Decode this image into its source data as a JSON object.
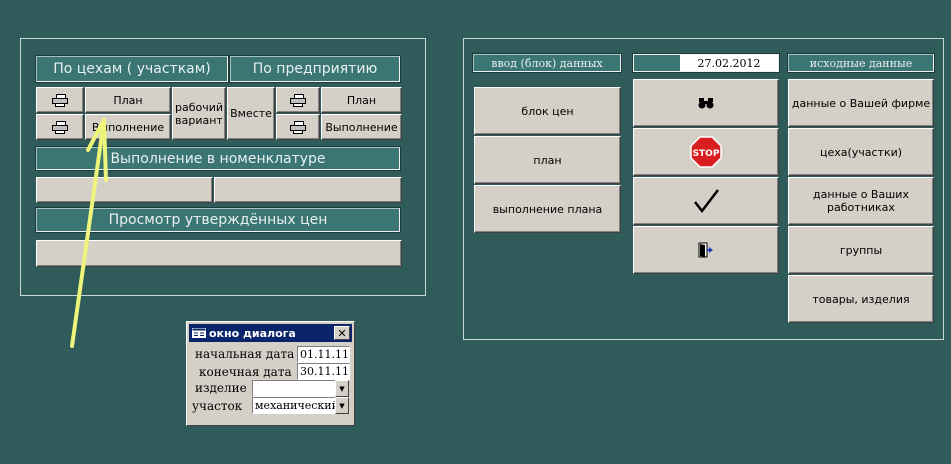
{
  "left_panel": {
    "tab_by_shops": "По цехам ( участкам)",
    "tab_by_enterprise": "По предприятию",
    "plan_label": "План",
    "execution_label": "Выполнение",
    "working_variant_label": "рабочий вариант",
    "together_label": "Вместе",
    "plan_label_right": "План",
    "execution_label_right": "Выполнение",
    "nomenclature_execution": "Выполнение в номенклатуре",
    "view_approved_prices": "Просмотр утверждённых цен"
  },
  "right_panel": {
    "data_entry_header": "ввод (блок) данных",
    "date": "27.02.2012",
    "source_data_header": "исходные данные",
    "entry_buttons": [
      "блок цен",
      "план",
      "выполнение плана"
    ],
    "action_icons": [
      "binoculars-icon",
      "stop-icon",
      "checkmark-icon",
      "exit-door-icon"
    ],
    "stop_text": "STOP",
    "source_buttons": [
      "данные о Вашей фирме",
      "цеха(участки)",
      "данные о Ваших работниках",
      "группы",
      "товары, изделия"
    ]
  },
  "dialog": {
    "title": "окно диалога",
    "close": "✕",
    "start_date_label": "начальная дата",
    "start_date_value": "01.11.11",
    "end_date_label": "конечная дата",
    "end_date_value": "30.11.11",
    "product_label": "изделие",
    "product_value": "",
    "section_label": "участок",
    "section_value": "механический"
  },
  "colors": {
    "background": "#2f5b5b",
    "teal_bar": "#3b7675",
    "button": "#d4d0c8",
    "annotation_arrow": "#eef57a"
  }
}
